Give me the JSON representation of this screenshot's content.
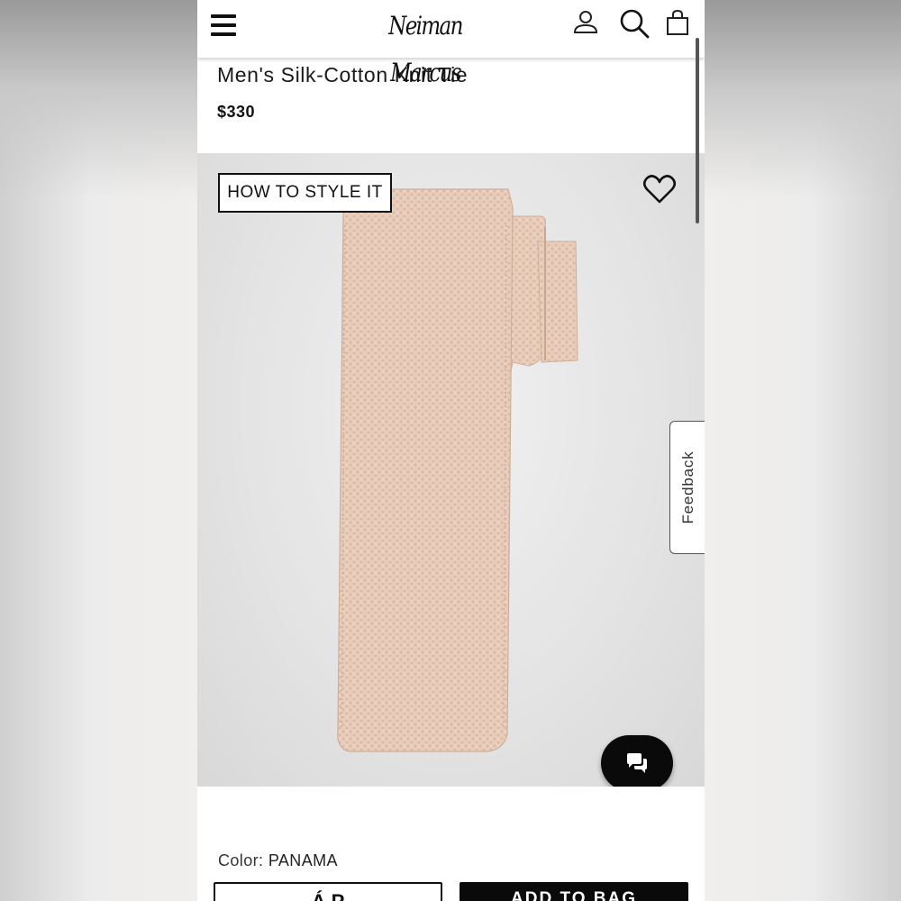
{
  "header": {
    "brand": "Neiman Marcus",
    "icons": [
      "menu-icon",
      "account-icon",
      "search-icon",
      "shopping-bag-icon"
    ]
  },
  "product": {
    "title": "Men's Silk-Cotton Knit Tie",
    "price": "$330",
    "style_button": "HOW TO STYLE IT",
    "color_label": "Color:",
    "color_value": "PANAMA",
    "tie_color": "#e8cdbb"
  },
  "feedback": {
    "label": "Feedback"
  },
  "actions": {
    "secondary_label": "Á P",
    "primary_label": "ADD TO BAG"
  },
  "colors": {
    "accent": "#0a0a0a",
    "image_bg": "#e6e6e6"
  }
}
